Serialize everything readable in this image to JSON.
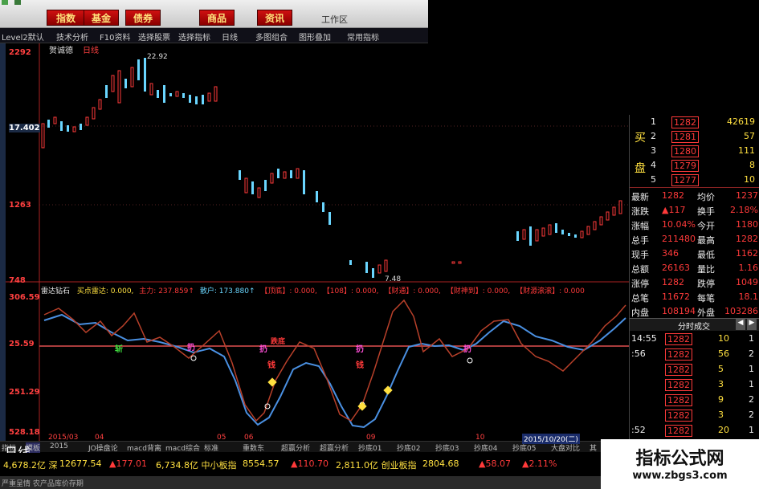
{
  "menu": {
    "items": [
      "指数",
      "基金",
      "债券",
      "商品",
      "资讯"
    ],
    "workzone": "工作区"
  },
  "toolbar": [
    "Level2默认",
    "技术分析",
    "F10资料",
    "选择股票",
    "选择指标",
    "日线",
    "多图组合",
    "图形叠加",
    "常用指标"
  ],
  "chart": {
    "stock_name": "贺诚德",
    "period_label": "日线",
    "price_labels": [
      "2292",
      "17.402",
      "1263",
      "748"
    ],
    "high_note": "22.92",
    "low_note": "7.48",
    "indicator_labels": [
      "306.59",
      "25.59",
      "251.29",
      "528.18"
    ]
  },
  "indicator_header": {
    "name": "雷达钻石",
    "items": [
      "买点雷达: 0.000,",
      "主力: 237.859↑",
      "散户: 173.880↑",
      "【顶底】: 0.000,",
      "【108】: 0.000,",
      "【财通】: 0.000,",
      "【财神到】: 0.000,",
      "【财源滚滚】: 0.000"
    ]
  },
  "markers": [
    "斩",
    "扔",
    "扔",
    "跌底",
    "扔",
    "钱",
    "钱",
    "扔"
  ],
  "sidepanel": {
    "book_labels": {
      "buy": "买",
      "sell": "盘"
    },
    "bids": [
      {
        "level": "1",
        "price": "1282",
        "vol": "42619"
      },
      {
        "level": "2",
        "price": "1281",
        "vol": "57"
      },
      {
        "level": "3",
        "price": "1280",
        "vol": "111"
      },
      {
        "level": "4",
        "price": "1279",
        "vol": "8"
      },
      {
        "level": "5",
        "price": "1277",
        "vol": "10"
      }
    ],
    "stats": [
      {
        "k1": "最新",
        "v1": "1282",
        "k2": "均价",
        "v2": "1237"
      },
      {
        "k1": "涨跌",
        "v1": "▲117",
        "k2": "换手",
        "v2": "2.18%"
      },
      {
        "k1": "涨幅",
        "v1": "10.04%",
        "k2": "今开",
        "v2": "1180"
      },
      {
        "k1": "总手",
        "v1": "211480",
        "k2": "最高",
        "v2": "1282"
      },
      {
        "k1": "现手",
        "v1": "346",
        "k2": "最低",
        "v2": "1162"
      },
      {
        "k1": "总额",
        "v1": "26163",
        "k2": "量比",
        "v2": "1.16"
      },
      {
        "k1": "涨停",
        "v1": "1282",
        "k2": "跌停",
        "v2": "1049"
      },
      {
        "k1": "总笔",
        "v1": "11672",
        "k2": "每笔",
        "v2": "18.1"
      },
      {
        "k1": "内盘",
        "v1": "108194",
        "k2": "外盘",
        "v2": "103286"
      }
    ],
    "trades_title": "分时成交",
    "trades": [
      {
        "time": "14:55",
        "price": "1282",
        "vol": "10",
        "num": "1"
      },
      {
        "time": ":56",
        "price": "1282",
        "vol": "56",
        "num": "2"
      },
      {
        "time": "",
        "price": "1282",
        "vol": "5",
        "num": "1"
      },
      {
        "time": "",
        "price": "1282",
        "vol": "3",
        "num": "1"
      },
      {
        "time": "",
        "price": "1282",
        "vol": "9",
        "num": "2"
      },
      {
        "time": "",
        "price": "1282",
        "vol": "3",
        "num": "2"
      },
      {
        "time": ":52",
        "price": "1282",
        "vol": "20",
        "num": "1"
      }
    ]
  },
  "tabs": [
    "指标",
    "模板",
    "2015",
    "JO操盘论",
    "macd背离",
    "macd综合",
    "标准",
    "重数东",
    "超赢分析",
    "超赢分析",
    "抄底01",
    "抄底02",
    "抄底03",
    "抄底04",
    "抄底05",
    "大盘对比",
    "其"
  ],
  "date_bar": {
    "left": "2015/03",
    "m1": "04",
    "m2": "05",
    "m3": "06",
    "m4": "09",
    "m5": "10",
    "right": "2015/10/20(二)",
    "sel": "日线"
  },
  "tape": [
    {
      "v": "4,678.2亿 深",
      "c": "yel"
    },
    {
      "v": "12677.54",
      "c": "yel"
    },
    {
      "v": "▲177.01",
      "c": "red"
    },
    {
      "v": "6,734.8亿 中小板指",
      "c": "yel"
    },
    {
      "v": "8554.57",
      "c": "yel"
    },
    {
      "v": "▲110.70",
      "c": "red"
    },
    {
      "v": "2,811.0亿 创业板指",
      "c": "yel"
    },
    {
      "v": "2804.68",
      "c": "yel"
    },
    {
      "v": "▲58.07",
      "c": "red"
    },
    {
      "v": "▲2.11%",
      "c": "red"
    }
  ],
  "status": "严重呈情 农产品库价存期",
  "watermark": {
    "title": "指标公式网",
    "url": "www.zbgs3.com"
  },
  "colors": {
    "up": "#ff3a3a",
    "down": "#6ad6ff",
    "line1": "#4a90e2",
    "line2": "#b8402a"
  }
}
